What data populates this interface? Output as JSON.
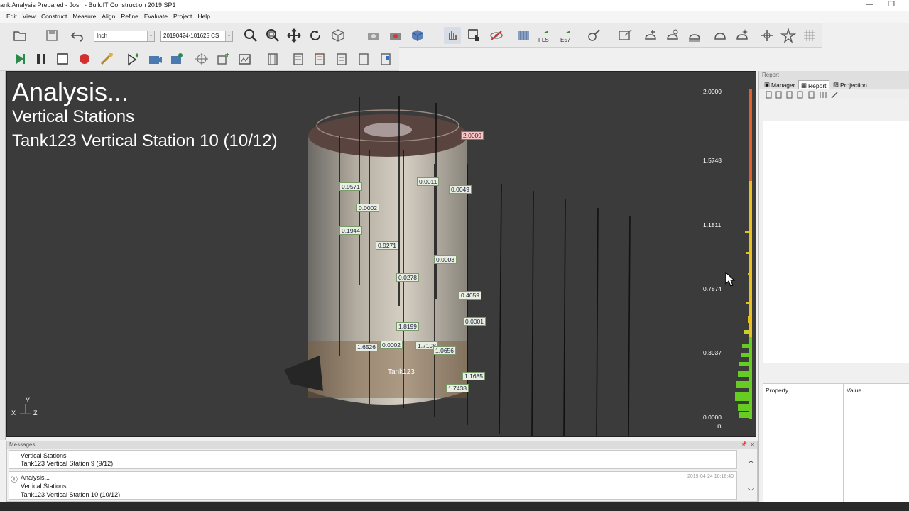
{
  "window": {
    "title": "ank Analysis Prepared - Josh - BuildIT Construction 2019 SP1",
    "minimize_glyph": "—",
    "restore_glyph": "❐"
  },
  "menu": [
    "Edit",
    "View",
    "Construct",
    "Measure",
    "Align",
    "Refine",
    "Evaluate",
    "Project",
    "Help"
  ],
  "toolbar": {
    "units_value": "Inch",
    "cs_value": "20190424-101625 CS",
    "fls_label": "FLS",
    "e57_label": "E57",
    "dropdown_glyph": "▾"
  },
  "viewport": {
    "heading1": "Analysis...",
    "heading2": "Vertical Stations",
    "heading3": "Tank123 Vertical Station 10 (10/12)",
    "object_label": "Tank123",
    "axis_y": "Y",
    "axis_x": "X",
    "axis_z": "Z",
    "deviation_labels": [
      {
        "text": "2.0009",
        "red": true
      },
      {
        "text": "0.9571"
      },
      {
        "text": "0.0011"
      },
      {
        "text": "0.0049"
      },
      {
        "text": "0.0002"
      },
      {
        "text": "0.1944"
      },
      {
        "text": "0.9271"
      },
      {
        "text": "0.0003"
      },
      {
        "text": "0.0278"
      },
      {
        "text": "0.4059"
      },
      {
        "text": "0.0001"
      },
      {
        "text": "1.8199"
      },
      {
        "text": "1.6526"
      },
      {
        "text": "0.0002"
      },
      {
        "text": "1.7198"
      },
      {
        "text": "1.0656"
      },
      {
        "text": "1.1685"
      },
      {
        "text": "1.7438"
      }
    ],
    "scale": {
      "ticks": [
        "2.0000",
        "1.5748",
        "1.1811",
        "0.7874",
        "0.3937",
        "0.0000"
      ],
      "unit": "in",
      "histogram_top_color": "#e0602a",
      "histogram_mid_color": "#e8c020",
      "histogram_bottom_color": "#66cc22"
    }
  },
  "right_panel": {
    "header": "Report",
    "tabs": [
      "Manager",
      "Report",
      "Projection"
    ],
    "active_tab": "Report",
    "property_col": "Property",
    "value_col": "Value"
  },
  "messages": {
    "header": "Messages",
    "pin_glyph": "📌",
    "close_glyph": "✕",
    "entry1": [
      "Vertical Stations",
      "Tank123 Vertical Station 9 (9/12)"
    ],
    "entry2_icon": "ⓘ",
    "entry2": [
      "Analysis...",
      "Vertical Stations",
      "Tank123 Vertical Station 10 (10/12)"
    ],
    "entry2_time": "2019-04-24 10:16:40",
    "scroll_up": "︿",
    "scroll_down": "﹀"
  }
}
